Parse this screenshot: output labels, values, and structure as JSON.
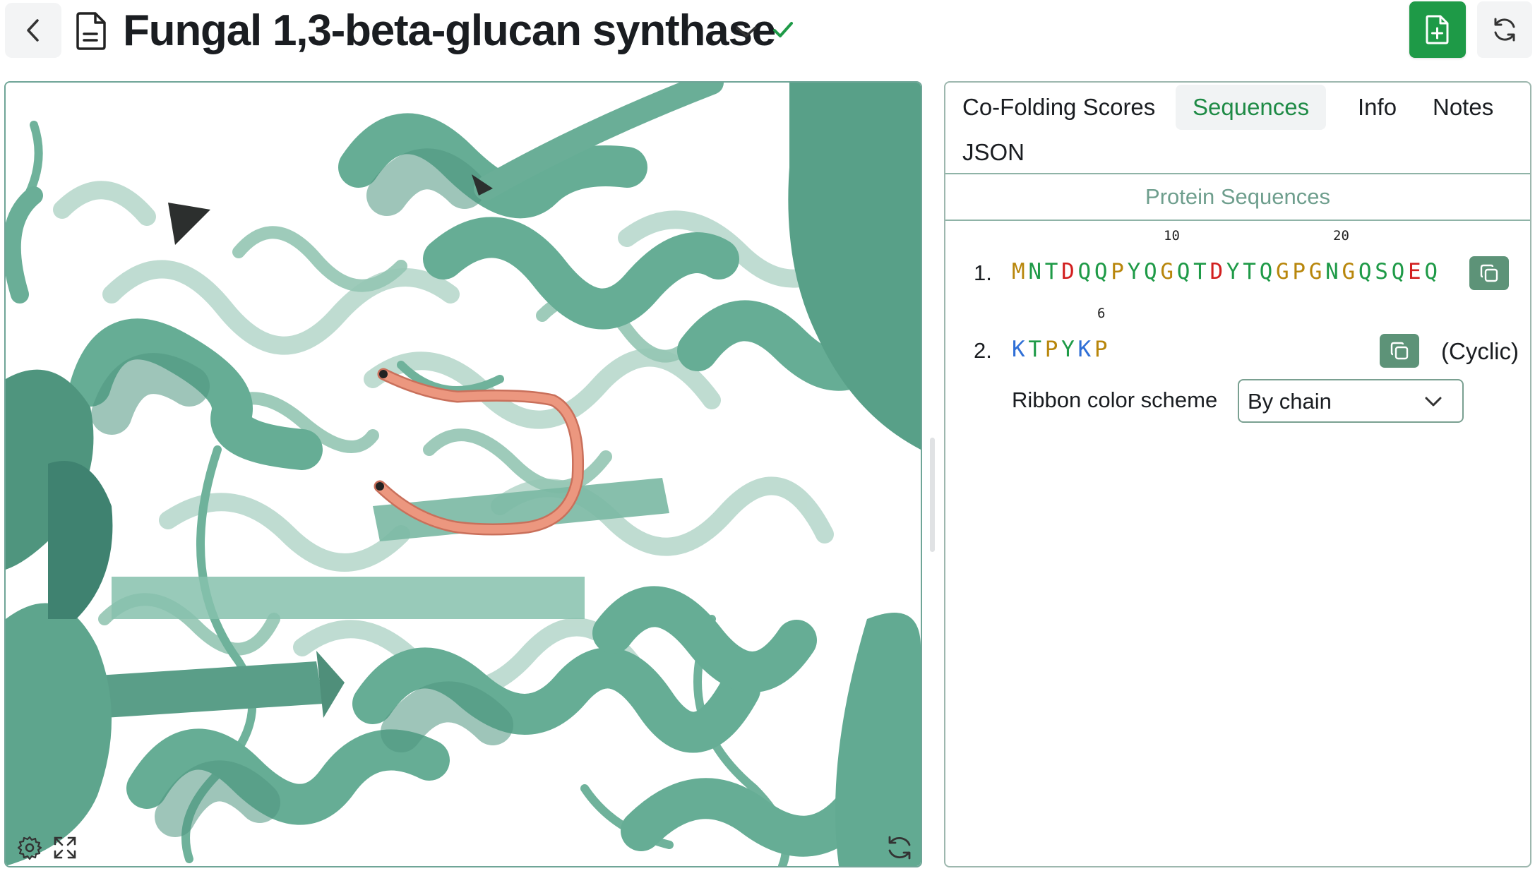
{
  "header": {
    "title": "Fungal 1,3-beta-glucan synthase",
    "back_icon": "chevron-left-icon",
    "doc_icon": "document-icon",
    "verified_icon": "checkmark-icon",
    "new_doc_icon": "file-plus-icon",
    "refresh_icon": "refresh-icon"
  },
  "tabs": [
    {
      "label": "Co-Folding Scores",
      "active": false
    },
    {
      "label": "Sequences",
      "active": true
    },
    {
      "label": "Info",
      "active": false
    },
    {
      "label": "Notes",
      "active": false
    },
    {
      "label": "JSON",
      "active": false
    }
  ],
  "sequences": {
    "section_title": "Protein Sequences",
    "items": [
      {
        "number": "1.",
        "residues": "MNTDQQPYQGQTDYTQGPGNGQSQEQ",
        "ruler": [
          "10",
          "20"
        ],
        "copy_icon": "copy-icon",
        "tag": ""
      },
      {
        "number": "2.",
        "residues": "KTPYKP",
        "ruler": [
          "6"
        ],
        "copy_icon": "copy-icon",
        "tag": "(Cyclic)"
      }
    ],
    "residue_colors": {
      "orange": "#b8860b",
      "green": "#1e9a47",
      "red": "#d21f1f",
      "blue": "#2f6fd6"
    }
  },
  "ribbon": {
    "label": "Ribbon color scheme",
    "value": "By chain"
  },
  "viewer": {
    "protein_color": "#5fa88f",
    "peptide_color": "#e8907a",
    "settings_icon": "gear-icon",
    "expand_icon": "expand-icon",
    "rotate_icon": "rotate-icon"
  },
  "colors": {
    "accent": "#1e9a47",
    "tab_active": "#1e8a45"
  }
}
